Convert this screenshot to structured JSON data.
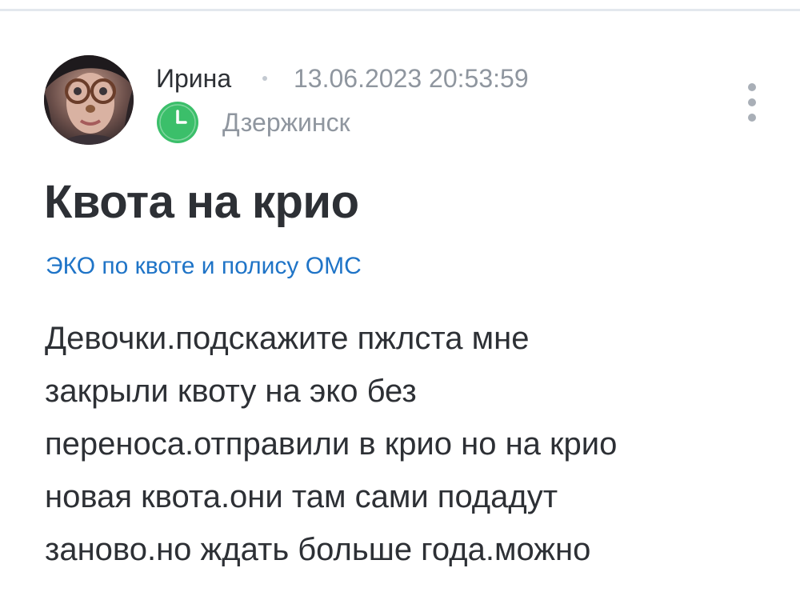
{
  "post": {
    "author": {
      "name": "Ирина",
      "timestamp": "13.06.2023 20:53:59",
      "city": "Дзержинск"
    },
    "title": "Квота на крио",
    "category": "ЭКО по квоте и полису ОМС",
    "body": "Девочки.подскажите пжлста мне\nзакрыли квоту на эко без\nпереноса.отправили в крио но на крио\nновая квота.они там сами подадут\nзаново.но ждать больше года.можно"
  },
  "icons": {
    "avatar": "user-avatar",
    "clock": "clock-icon",
    "more": "more-vertical-icon"
  },
  "colors": {
    "text": "#2d3035",
    "muted": "#8f969f",
    "link": "#1f74c7",
    "clock_green": "#3bbf6a",
    "divider": "#e3e8ee"
  }
}
